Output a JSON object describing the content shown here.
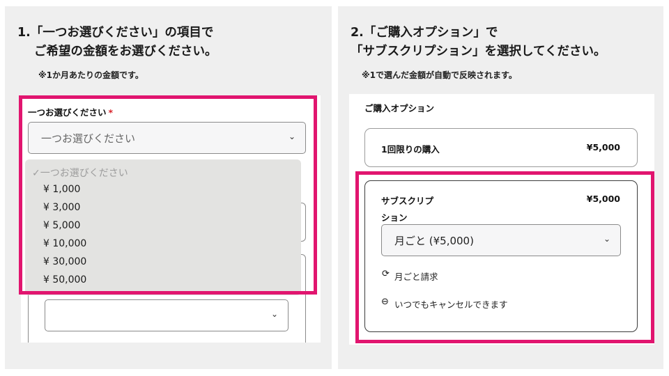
{
  "left": {
    "heading_line1": "1.「一つお選びください」の項目で",
    "heading_line2": "ご希望の金額をお選びください。",
    "note": "※1か月あたりの金額です。",
    "field_label": "一つお選びください",
    "required_mark": "*",
    "select_placeholder": "一つお選びください",
    "dropdown_options": [
      "一つお選びください",
      "¥ 1,000",
      "¥ 3,000",
      "¥ 5,000",
      "¥ 10,000",
      "¥ 30,000",
      "¥ 50,000"
    ],
    "checkmark": "✓"
  },
  "right": {
    "heading_line1": "2.「ご購入オプション」で",
    "heading_line2": "「サブスクリプション」を選択してください。",
    "note": "※1で選んだ金額が自動で反映されます。",
    "options_label": "ご購入オプション",
    "one_time_label": "1回限りの購入",
    "one_time_price": "¥5,000",
    "subscription_label_line1": "サブスクリプ",
    "subscription_label_line2": "ション",
    "subscription_price": "¥5,000",
    "frequency_select": "月ごと (¥5,000)",
    "billing_text": "月ごと請求",
    "cancel_text": "いつでもキャンセルできます"
  },
  "colors": {
    "highlight": "#e1156f",
    "panel_bg": "#efefef",
    "dropdown_bg": "#e3e3e1",
    "required": "#d8232a"
  }
}
